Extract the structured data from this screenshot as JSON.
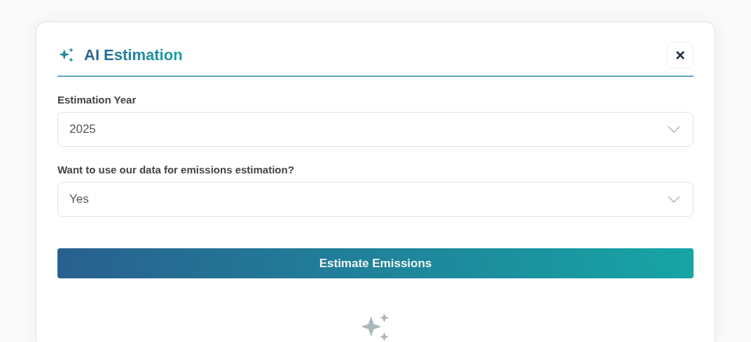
{
  "dialog": {
    "title": "AI Estimation",
    "close_label": "×"
  },
  "fields": [
    {
      "label": "Estimation Year",
      "value": "2025"
    },
    {
      "label": "Want to use our data for emissions estimation?",
      "value": "Yes"
    }
  ],
  "primary_button": "Estimate Emissions"
}
